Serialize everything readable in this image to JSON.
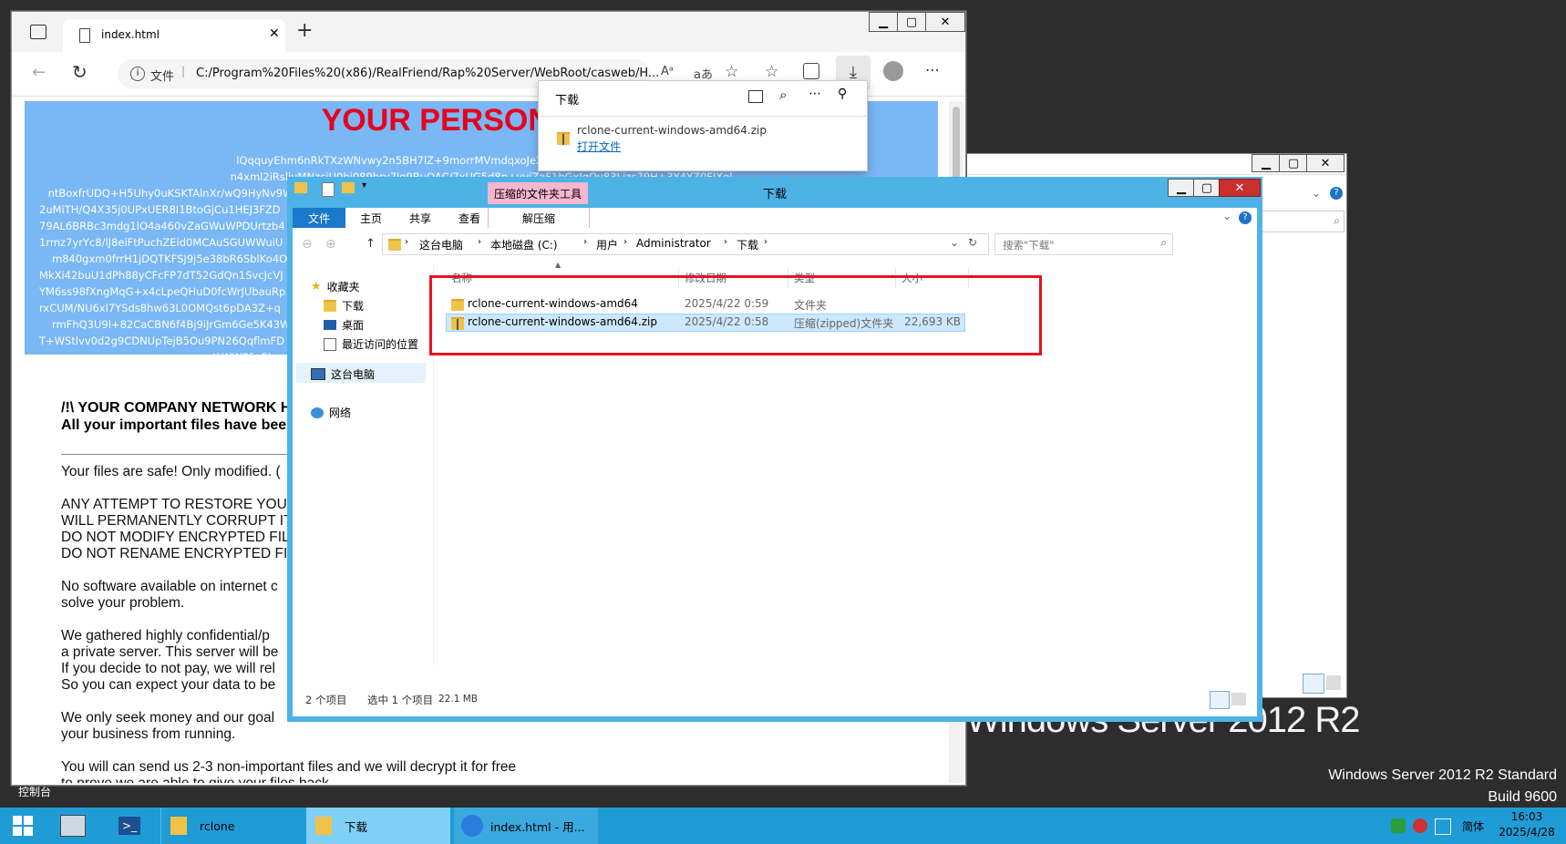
{
  "desktop": {
    "os_name": "Windows Server 2012 R2 Standard",
    "build": "Build 9600",
    "logo_text": "Windows Server 2012 R2",
    "console_label": "控制台"
  },
  "browser": {
    "tab_title": "index.html",
    "new_tab": "+",
    "address_prefix": "文件",
    "address": "C:/Program%20Files%20(x86)/RealFriend/Rap%20Server/WebRoot/casweb/H...",
    "read_aloud": "Aᵃ",
    "translate": "aあ",
    "page": {
      "banner_title": "YOUR PERSONAL ID:",
      "cipher_lines": [
        "lQqquyEhm6nRkTXzWNvwy2n5BH7lZ+9morrMVmdqxoJe2xftthGLJPynu4Vt9udEYKFiNPTMZp3",
        "n4xml2iRsliuMNzcjU0bi089bry7lq9BuOAC/7xUG5d8p+vviZaF1bGxJgOy83Ljzc79H+3Y4YZ0FJXol",
        "ntBoxfrUDQ+H5Uhy0uKSKTAlnXr/wQ9HyNv9WqeFqfh+dO+trB4iWFL0gvq9a6BLmk7NJbacj4R2m/RSVVQp1c628ahdGqOUi2y6rwah5PDRe1VO9cInRcwBKud3/s1dGF9z",
        "2uMiTH/Q4X35j0UPxUER8I1BtoGjCu1HEJ3FZD",
        "79AL6BRBc3mdg1lO4a460vZaGWuWPDUrtzb4",
        "1rmz7yrYc8/lJ8eiFtPuchZEid0MCAuSGUWWuiU",
        "m840gxm0frrH1jDQTKFSJ9j5e38bR6SblKo4OM",
        "MkXi42buU1dPh88yCFcFP7dT52GdQn1SvcJcVJ",
        "YM6ss98fXngMqG+x4cLpeQHuD0fcWrJUbauRp",
        "rxCUM/NU6xl7YSds8hw63L0OMQst6pDA3Z+q",
        "rmFhQ3U9l+82CaCBN6f4Bj9iJrGm6Ge5K43W2",
        "T+WStlvv0d2g9CDNUpTejB5Ou9PN26QqflmFD",
        "gvtLWWSf+5hooYa"
      ],
      "heading1": "/!\\ YOUR COMPANY NETWORK H",
      "heading2": "All your important files have bee",
      "p1": "Your files are safe! Only modified. (",
      "p2": "ANY ATTEMPT TO RESTORE YOUR\nWILL PERMANENTLY CORRUPT IT.\nDO NOT MODIFY ENCRYPTED FILE\nDO NOT RENAME ENCRYPTED FILE",
      "p3": "No software available on internet c\nsolve your problem.",
      "p4": "We gathered highly confidential/p\na private server. This server will be\nIf you decide to not pay, we will rel\nSo you can expect your data to be",
      "p5": "We only seek money and our goal\nyour business from running.",
      "p6": "You will can send us 2-3 non-important files and we will decrypt it for free\nto prove we are able to give your files back."
    }
  },
  "download_popup": {
    "title": "下载",
    "file_name": "rclone-current-windows-amd64.zip",
    "open_file": "打开文件"
  },
  "explorer": {
    "title": "下载",
    "contextual_tab": "压缩的文件夹工具",
    "tabs": [
      "文件",
      "主页",
      "共享",
      "查看"
    ],
    "extract_tab": "解压缩",
    "breadcrumb": [
      "这台电脑",
      "本地磁盘 (C:)",
      "用户",
      "Administrator",
      "下载"
    ],
    "search_placeholder": "搜索\"下载\"",
    "nav": {
      "favorites": "收藏夹",
      "downloads": "下载",
      "desktop": "桌面",
      "recent": "最近访问的位置",
      "this_pc": "这台电脑",
      "network": "网络"
    },
    "columns": [
      "名称",
      "修改日期",
      "类型",
      "大小"
    ],
    "rows": [
      {
        "name": "rclone-current-windows-amd64",
        "date": "2025/4/22 0:59",
        "type": "文件夹",
        "size": ""
      },
      {
        "name": "rclone-current-windows-amd64.zip",
        "date": "2025/4/22 0:58",
        "type": "压缩(zipped)文件夹",
        "size": "22,693 KB"
      }
    ],
    "status_count": "2 个项目",
    "status_selected": "选中 1 个项目",
    "status_size": "22.1 MB"
  },
  "taskbar": {
    "items": [
      {
        "label": "rclone"
      },
      {
        "label": "下载"
      },
      {
        "label": "index.html - 用..."
      }
    ],
    "ime": "简体",
    "time": "16:03",
    "date": "2025/4/28"
  },
  "colors": {
    "banner_bg": "#79b7f5",
    "banner_title": "#e8001c",
    "highlight_box": "#e81123",
    "taskbar": "#1f9bd6",
    "explorer_frame": "#4db3e6"
  }
}
